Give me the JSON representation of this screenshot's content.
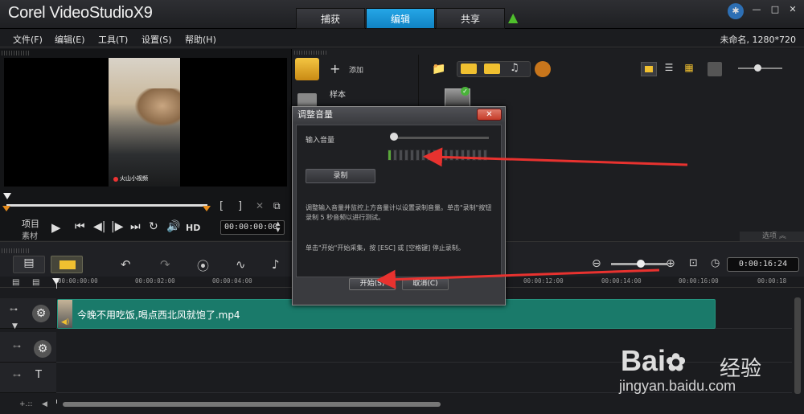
{
  "app": {
    "logo_prefix": "Corel",
    "logo_name": " VideoStudio",
    "logo_version": "X9"
  },
  "tabs": [
    {
      "label": "捕获"
    },
    {
      "label": "编辑"
    },
    {
      "label": "共享"
    }
  ],
  "menu": [
    "文件(F)",
    "编辑(E)",
    "工具(T)",
    "设置(S)",
    "帮助(H)"
  ],
  "project_info": "未命名, 1280*720",
  "preview": {
    "watermark": "火山小视频",
    "project_label": "项目",
    "clip_label": "素材",
    "timecode": "00:00:00:00",
    "hd_label": "HD"
  },
  "library": {
    "add_label": "添加",
    "sample_label": "样本",
    "options_label": "选项"
  },
  "timeline": {
    "time_display": "0:00:16:24",
    "ruler_ticks": [
      "00:00:00:00",
      "00:00:02:00",
      "00:00:04:00",
      "00:00:12:00",
      "00:00:14:00",
      "00:00:16:00",
      "00:00:18"
    ],
    "clip_name": "今晚不用吃饭,喝点西北风就饱了.mp4"
  },
  "dialog": {
    "title": "调整音量",
    "input_volume_label": "输入音量",
    "record_button": "录制",
    "help_text_1": "调整输入音量并监控上方音量计以设置录制音量。单击\"录制\"按钮录制 5 秒音频以进行测试。",
    "help_text_2": "单击\"开始\"开始采集，按 [ESC] 或 [空格键] 停止录制。",
    "start_button": "开始(S)",
    "cancel_button": "取消(C)",
    "meter_segments_total": 18,
    "meter_segments_active": 1
  },
  "watermark": {
    "logo": "Bai",
    "logo_cn": "经验",
    "url": "jingyan.baidu.com"
  },
  "colors": {
    "active_tab": "#1d94d6",
    "clip": "#1a7a6a",
    "arrow": "#e8322f",
    "meter_on": "#5aa83a"
  }
}
